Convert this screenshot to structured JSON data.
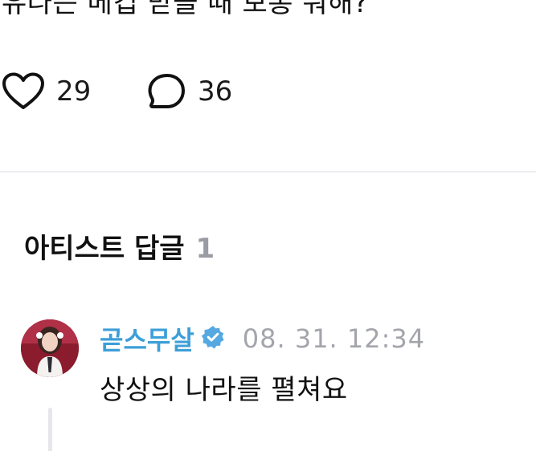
{
  "post": {
    "text": "유나는 메컵 받을 때 보통 뭐해?",
    "likes": "29",
    "comments": "36"
  },
  "section": {
    "title": "아티스트 답글",
    "count": "1"
  },
  "reply": {
    "author": "곧스무살",
    "verified": true,
    "timestamp": "08. 31. 12:34",
    "text": "상상의 나라를 펼쳐요"
  },
  "colors": {
    "author": "#3d9fd8",
    "muted": "#a3a5ab",
    "badge": "#55a9e0",
    "divider": "#ecedf0"
  },
  "icons": {
    "like": "heart-icon",
    "comment": "speech-bubble-icon",
    "verified": "verified-badge-icon"
  }
}
